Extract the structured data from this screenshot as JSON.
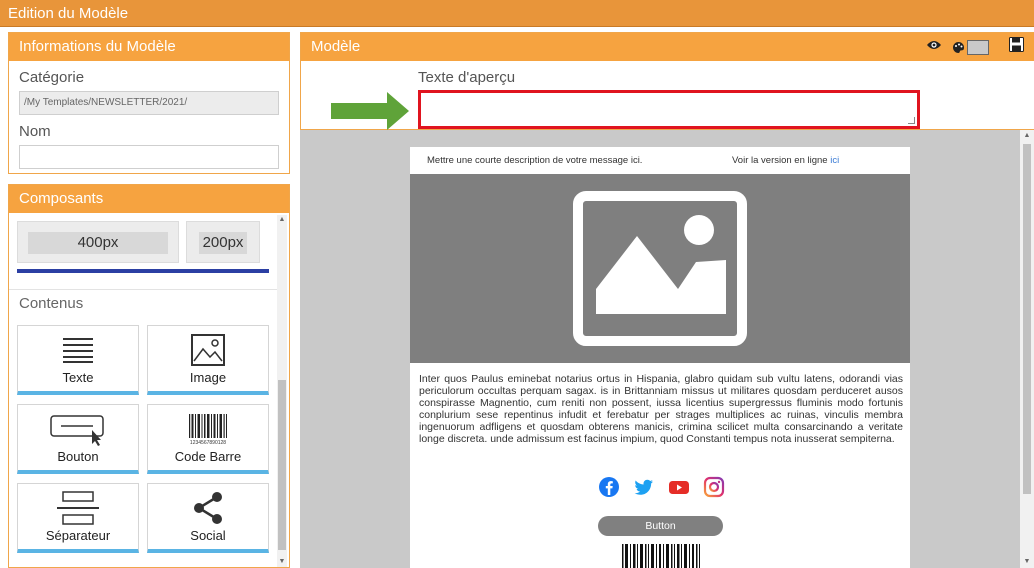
{
  "window": {
    "title": "Edition du Modèle"
  },
  "info_panel": {
    "title": "Informations du Modèle",
    "category_label": "Catégorie",
    "category_value": "/My Templates/NEWSLETTER/2021/",
    "name_label": "Nom",
    "name_value": ""
  },
  "components_panel": {
    "title": "Composants",
    "sizes": [
      "400px",
      "200px"
    ],
    "contents_label": "Contenus",
    "tiles": [
      {
        "label": "Texte",
        "icon": "text-icon"
      },
      {
        "label": "Image",
        "icon": "image-icon"
      },
      {
        "label": "Bouton",
        "icon": "button-icon"
      },
      {
        "label": "Code Barre",
        "icon": "barcode-icon"
      },
      {
        "label": "Séparateur",
        "icon": "separator-icon"
      },
      {
        "label": "Social",
        "icon": "share-icon"
      }
    ]
  },
  "model_panel": {
    "title": "Modèle",
    "tools": [
      "eye-icon",
      "palette-icon",
      "save-icon"
    ],
    "preview_label": "Texte d'aperçu",
    "preview_value": ""
  },
  "email": {
    "preheader": "Mettre une courte description de votre message ici.",
    "view_online": "Voir la version en ligne",
    "view_online_link": "ici",
    "body_text": "Inter quos Paulus eminebat notarius ortus in Hispania, glabro quidam sub vultu latens, odorandi vias periculorum occultas perquam sagax. is in Brittanniam missus ut militares quosdam perduceret ausos conspirasse Magnentio, cum reniti non possent, iussa licentius supergressus fluminis modo fortunis conplurium sese repentinus infudit et ferebatur per strages multiplices ac ruinas, vinculis membra ingenuorum adfligens et quosdam obterens manicis, crimina scilicet multa consarcinando a veritate longe discreta. unde admissum est facinus impium, quod Constanti tempus nota inusserat sempiterna.",
    "social_icons": [
      "facebook-icon",
      "twitter-icon",
      "youtube-icon",
      "instagram-icon"
    ],
    "button_label": "Button",
    "barcode_digits": "1234567890128"
  },
  "colors": {
    "header_orange": "#f6a340",
    "highlight_red": "#e0141f",
    "arrow_green": "#5fa339",
    "tile_accent": "#5ab4e4"
  }
}
